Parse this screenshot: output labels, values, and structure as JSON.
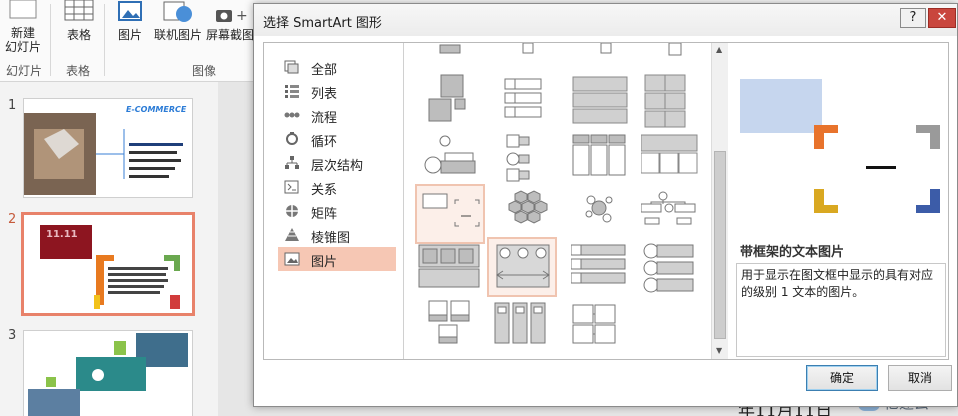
{
  "ribbon": {
    "new_slide_line1": "新建",
    "new_slide_line2": "幻灯片",
    "table_label": "表格",
    "picture_label": "图片",
    "online_picture_label": "联机图片",
    "screenshot_label": "屏幕截图",
    "group_slides": "幻灯片",
    "group_tables": "表格",
    "group_images": "图像"
  },
  "slides": {
    "numbers": [
      "1",
      "2",
      "3"
    ],
    "slide1_title": "E-COMMERCE",
    "slide2_badge": "11.11"
  },
  "background": {
    "doc_text": "年11月11日",
    "watermark": "亿速云"
  },
  "dialog": {
    "title": "选择 SmartArt 图形",
    "help": "?",
    "close": "✕",
    "categories": [
      {
        "label": "全部",
        "icon": "all-icon"
      },
      {
        "label": "列表",
        "icon": "list-icon"
      },
      {
        "label": "流程",
        "icon": "process-icon"
      },
      {
        "label": "循环",
        "icon": "cycle-icon"
      },
      {
        "label": "层次结构",
        "icon": "hierarchy-icon"
      },
      {
        "label": "关系",
        "icon": "relationship-icon"
      },
      {
        "label": "矩阵",
        "icon": "matrix-icon"
      },
      {
        "label": "棱锥图",
        "icon": "pyramid-icon"
      },
      {
        "label": "图片",
        "icon": "picture-icon"
      }
    ],
    "selected_category": "图片",
    "preview_title": "带框架的文本图片",
    "preview_description": "用于显示在图文框中显示的具有对应的级别 1 文本的图片。",
    "ok": "确定",
    "cancel": "取消"
  },
  "colors": {
    "accent_selection": "#f6c7b4",
    "preview_fill": "#c6d6ee",
    "corner_orange": "#e8732c",
    "corner_gray": "#9a9a9a",
    "corner_gold": "#d9a821",
    "corner_blue": "#3c5ca8"
  }
}
